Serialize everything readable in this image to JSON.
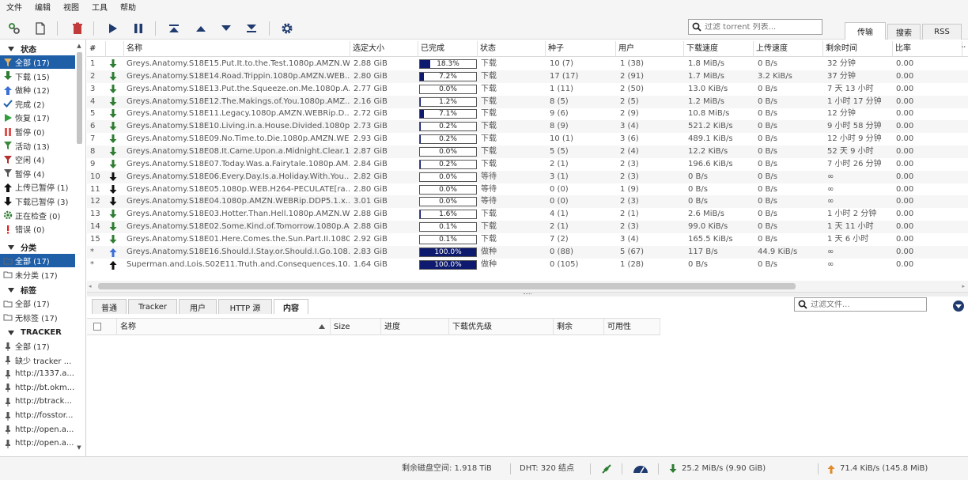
{
  "menu": [
    "文件",
    "编辑",
    "视图",
    "工具",
    "帮助"
  ],
  "search": {
    "placeholder": "过滤 torrent 列表..."
  },
  "top_tabs": [
    "传输",
    "搜索",
    "RSS"
  ],
  "sidebar": {
    "status_header": "状态",
    "status_items": [
      {
        "label": "全部 (17)",
        "icon": "filter-icon",
        "color": "#e39a2d"
      },
      {
        "label": "下载 (15)",
        "icon": "download-arrow-icon",
        "color": "#2e7d32"
      },
      {
        "label": "做种 (12)",
        "icon": "upload-arrow-icon",
        "color": "#3a6fd8"
      },
      {
        "label": "完成 (2)",
        "icon": "check-icon",
        "color": "#1f5fa8"
      },
      {
        "label": "恢复 (17)",
        "icon": "play-icon",
        "color": "#2e9d3a"
      },
      {
        "label": "暂停 (0)",
        "icon": "pause-icon",
        "color": "#e05050"
      },
      {
        "label": "活动 (13)",
        "icon": "filter-icon",
        "color": "#3a8a3a"
      },
      {
        "label": "空闲 (4)",
        "icon": "filter-icon",
        "color": "#b23030"
      },
      {
        "label": "暂停 (4)",
        "icon": "filter-icon",
        "color": "#555555"
      },
      {
        "label": "上传已暂停 (1)",
        "icon": "upload-paused-icon",
        "color": "#111111"
      },
      {
        "label": "下载已暂停 (3)",
        "icon": "download-paused-icon",
        "color": "#111111"
      },
      {
        "label": "正在检查 (0)",
        "icon": "gear-icon",
        "color": "#2e7d32"
      },
      {
        "label": "错误 (0)",
        "icon": "error-icon",
        "color": "#e02020"
      }
    ],
    "category_header": "分类",
    "category_items": [
      "全部 (17)",
      "未分类 (17)"
    ],
    "tag_header": "标签",
    "tag_items": [
      "全部 (17)",
      "无标签 (17)"
    ],
    "tracker_header": "TRACKER",
    "tracker_items": [
      "全部 (17)",
      "缺少 tracker ...",
      "http://1337.a...",
      "http://bt.okm...",
      "http://btrack...",
      "http://fosstor...",
      "http://open.a...",
      "http://open.a..."
    ]
  },
  "table": {
    "headers": [
      "#",
      "名称",
      "选定大小",
      "已完成",
      "状态",
      "种子",
      "用户",
      "下载速度",
      "上传速度",
      "剩余时间",
      "比率"
    ],
    "rows": [
      {
        "num": "1",
        "dir": "down",
        "name": "Greys.Anatomy.S18E15.Put.It.to.the.Test.1080p.AMZN.W...",
        "size": "2.88 GiB",
        "progress": 18.3,
        "progress_text": "18.3%",
        "status": "下载",
        "seeds": "10 (7)",
        "peers": "1 (38)",
        "dl": "1.8 MiB/s",
        "ul": "0 B/s",
        "eta": "32 分钟",
        "ratio": "0.00"
      },
      {
        "num": "2",
        "dir": "down",
        "name": "Greys.Anatomy.S18E14.Road.Trippin.1080p.AMZN.WEB...",
        "size": "2.80 GiB",
        "progress": 7.2,
        "progress_text": "7.2%",
        "status": "下载",
        "seeds": "17 (17)",
        "peers": "2 (91)",
        "dl": "1.7 MiB/s",
        "ul": "3.2 KiB/s",
        "eta": "37 分钟",
        "ratio": "0.00"
      },
      {
        "num": "3",
        "dir": "down",
        "name": "Greys.Anatomy.S18E13.Put.the.Squeeze.on.Me.1080p.A...",
        "size": "2.77 GiB",
        "progress": 0.0,
        "progress_text": "0.0%",
        "status": "下载",
        "seeds": "1 (11)",
        "peers": "2 (50)",
        "dl": "13.0 KiB/s",
        "ul": "0 B/s",
        "eta": "7 天 13 小时",
        "ratio": "0.00"
      },
      {
        "num": "4",
        "dir": "down",
        "name": "Greys.Anatomy.S18E12.The.Makings.of.You.1080p.AMZ...",
        "size": "2.16 GiB",
        "progress": 1.2,
        "progress_text": "1.2%",
        "status": "下载",
        "seeds": "8 (5)",
        "peers": "2 (5)",
        "dl": "1.2 MiB/s",
        "ul": "0 B/s",
        "eta": "1 小时 17 分钟",
        "ratio": "0.00"
      },
      {
        "num": "5",
        "dir": "down",
        "name": "Greys.Anatomy.S18E11.Legacy.1080p.AMZN.WEBRip.D...",
        "size": "2.72 GiB",
        "progress": 7.1,
        "progress_text": "7.1%",
        "status": "下载",
        "seeds": "9 (6)",
        "peers": "2 (9)",
        "dl": "10.8 MiB/s",
        "ul": "0 B/s",
        "eta": "12 分钟",
        "ratio": "0.00"
      },
      {
        "num": "6",
        "dir": "down",
        "name": "Greys.Anatomy.S18E10.Living.in.a.House.Divided.1080p...",
        "size": "2.73 GiB",
        "progress": 0.2,
        "progress_text": "0.2%",
        "status": "下载",
        "seeds": "8 (9)",
        "peers": "3 (4)",
        "dl": "521.2 KiB/s",
        "ul": "0 B/s",
        "eta": "9 小时 58 分钟",
        "ratio": "0.00"
      },
      {
        "num": "7",
        "dir": "down",
        "name": "Greys.Anatomy.S18E09.No.Time.to.Die.1080p.AMZN.WE...",
        "size": "2.93 GiB",
        "progress": 0.2,
        "progress_text": "0.2%",
        "status": "下载",
        "seeds": "10 (1)",
        "peers": "3 (6)",
        "dl": "489.1 KiB/s",
        "ul": "0 B/s",
        "eta": "12 小时 9 分钟",
        "ratio": "0.00"
      },
      {
        "num": "8",
        "dir": "down",
        "name": "Greys.Anatomy.S18E08.It.Came.Upon.a.Midnight.Clear.1...",
        "size": "2.87 GiB",
        "progress": 0.0,
        "progress_text": "0.0%",
        "status": "下载",
        "seeds": "5 (5)",
        "peers": "2 (4)",
        "dl": "12.2 KiB/s",
        "ul": "0 B/s",
        "eta": "52 天 9 小时",
        "ratio": "0.00"
      },
      {
        "num": "9",
        "dir": "down",
        "name": "Greys.Anatomy.S18E07.Today.Was.a.Fairytale.1080p.AM...",
        "size": "2.84 GiB",
        "progress": 0.2,
        "progress_text": "0.2%",
        "status": "下载",
        "seeds": "2 (1)",
        "peers": "2 (3)",
        "dl": "196.6 KiB/s",
        "ul": "0 B/s",
        "eta": "7 小时 26 分钟",
        "ratio": "0.00"
      },
      {
        "num": "10",
        "dir": "wait",
        "name": "Greys.Anatomy.S18E06.Every.Day.Is.a.Holiday.With.You...",
        "size": "2.82 GiB",
        "progress": 0.0,
        "progress_text": "0.0%",
        "status": "等待",
        "seeds": "3 (1)",
        "peers": "2 (3)",
        "dl": "0 B/s",
        "ul": "0 B/s",
        "eta": "∞",
        "ratio": "0.00"
      },
      {
        "num": "11",
        "dir": "wait",
        "name": "Greys.Anatomy.S18E05.1080p.WEB.H264-PECULATE[ra...",
        "size": "2.80 GiB",
        "progress": 0.0,
        "progress_text": "0.0%",
        "status": "等待",
        "seeds": "0 (0)",
        "peers": "1 (9)",
        "dl": "0 B/s",
        "ul": "0 B/s",
        "eta": "∞",
        "ratio": "0.00"
      },
      {
        "num": "12",
        "dir": "wait",
        "name": "Greys.Anatomy.S18E04.1080p.AMZN.WEBRip.DDP5.1.x...",
        "size": "3.01 GiB",
        "progress": 0.0,
        "progress_text": "0.0%",
        "status": "等待",
        "seeds": "0 (0)",
        "peers": "2 (3)",
        "dl": "0 B/s",
        "ul": "0 B/s",
        "eta": "∞",
        "ratio": "0.00"
      },
      {
        "num": "13",
        "dir": "down",
        "name": "Greys.Anatomy.S18E03.Hotter.Than.Hell.1080p.AMZN.W...",
        "size": "2.88 GiB",
        "progress": 1.6,
        "progress_text": "1.6%",
        "status": "下载",
        "seeds": "4 (1)",
        "peers": "2 (1)",
        "dl": "2.6 MiB/s",
        "ul": "0 B/s",
        "eta": "1 小时 2 分钟",
        "ratio": "0.00"
      },
      {
        "num": "14",
        "dir": "down",
        "name": "Greys.Anatomy.S18E02.Some.Kind.of.Tomorrow.1080p.A...",
        "size": "2.88 GiB",
        "progress": 0.1,
        "progress_text": "0.1%",
        "status": "下载",
        "seeds": "2 (1)",
        "peers": "2 (3)",
        "dl": "99.0 KiB/s",
        "ul": "0 B/s",
        "eta": "1 天 11 小时",
        "ratio": "0.00"
      },
      {
        "num": "15",
        "dir": "down",
        "name": "Greys.Anatomy.S18E01.Here.Comes.the.Sun.Part.II.1080...",
        "size": "2.92 GiB",
        "progress": 0.1,
        "progress_text": "0.1%",
        "status": "下载",
        "seeds": "7 (2)",
        "peers": "3 (4)",
        "dl": "165.5 KiB/s",
        "ul": "0 B/s",
        "eta": "1 天 6 小时",
        "ratio": "0.00"
      },
      {
        "num": "*",
        "dir": "seed",
        "name": "Greys.Anatomy.S18E16.Should.I.Stay.or.Should.I.Go.108...",
        "size": "2.83 GiB",
        "progress": 100,
        "progress_text": "100.0%",
        "status": "做种",
        "seeds": "0 (88)",
        "peers": "5 (67)",
        "dl": "117 B/s",
        "ul": "44.9 KiB/s",
        "eta": "∞",
        "ratio": "0.00"
      },
      {
        "num": "*",
        "dir": "up",
        "name": "Superman.and.Lois.S02E11.Truth.and.Consequences.10...",
        "size": "1.64 GiB",
        "progress": 100,
        "progress_text": "100.0%",
        "status": "做种",
        "seeds": "0 (105)",
        "peers": "1 (28)",
        "dl": "0 B/s",
        "ul": "0 B/s",
        "eta": "∞",
        "ratio": "0.00"
      }
    ]
  },
  "detail_tabs": [
    "普通",
    "Tracker",
    "用户",
    "HTTP 源",
    "内容"
  ],
  "file_search": {
    "placeholder": "过滤文件..."
  },
  "file_headers": [
    "名称",
    "Size",
    "进度",
    "下载优先级",
    "剩余",
    "可用性"
  ],
  "status": {
    "disk": "剩余磁盘空间: 1.918 TiB",
    "dht": "DHT: 320 结点",
    "dl": "25.2 MiB/s (9.90 GiB)",
    "ul": "71.4 KiB/s (145.8 MiB)"
  },
  "colors": {
    "selection": "#1f5fa8",
    "progress_fill": "#0d1a6e",
    "download_arrow": "#2e7d32",
    "upload_arrow": "#3a6fd8",
    "ul_status_arrow": "#e08a2a"
  }
}
